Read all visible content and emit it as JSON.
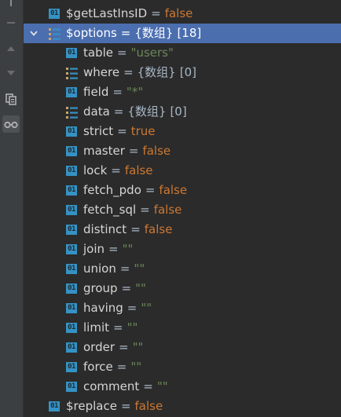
{
  "colors": {
    "selected_row": "#4b6eaf",
    "primitive_icon": "#3592c4",
    "false_value": "#cc7832",
    "string_value": "#6a8759",
    "background": "#2b2b2b"
  },
  "gutter": {
    "buttons": [
      {
        "name": "settings-icon"
      },
      {
        "name": "collapse-icon"
      },
      {
        "name": "up-arrow-icon"
      },
      {
        "name": "down-arrow-icon"
      },
      {
        "name": "copy-icon"
      },
      {
        "name": "glasses-icon",
        "active": true
      }
    ]
  },
  "rows": [
    {
      "level": 0,
      "icon": "primitive",
      "key": "$getLastInsID",
      "eq": "=",
      "value": "false",
      "kind": "false"
    },
    {
      "level": 0,
      "icon": "array",
      "key": "$options",
      "eq": "=",
      "value": "{数组}",
      "kind": "arr",
      "count": "[18]",
      "expanded": true,
      "selected": true
    },
    {
      "level": 1,
      "icon": "primitive",
      "key": "table",
      "eq": "=",
      "value": "\"users\"",
      "kind": "str"
    },
    {
      "level": 1,
      "icon": "array",
      "key": "where",
      "eq": "=",
      "value": "{数组}",
      "kind": "arr",
      "count": "[0]"
    },
    {
      "level": 1,
      "icon": "primitive",
      "key": "field",
      "eq": "=",
      "value": "\"*\"",
      "kind": "str"
    },
    {
      "level": 1,
      "icon": "array",
      "key": "data",
      "eq": "=",
      "value": "{数组}",
      "kind": "arr",
      "count": "[0]"
    },
    {
      "level": 1,
      "icon": "primitive",
      "key": "strict",
      "eq": "=",
      "value": "true",
      "kind": "true"
    },
    {
      "level": 1,
      "icon": "primitive",
      "key": "master",
      "eq": "=",
      "value": "false",
      "kind": "false"
    },
    {
      "level": 1,
      "icon": "primitive",
      "key": "lock",
      "eq": "=",
      "value": "false",
      "kind": "false"
    },
    {
      "level": 1,
      "icon": "primitive",
      "key": "fetch_pdo",
      "eq": "=",
      "value": "false",
      "kind": "false"
    },
    {
      "level": 1,
      "icon": "primitive",
      "key": "fetch_sql",
      "eq": "=",
      "value": "false",
      "kind": "false"
    },
    {
      "level": 1,
      "icon": "primitive",
      "key": "distinct",
      "eq": "=",
      "value": "false",
      "kind": "false"
    },
    {
      "level": 1,
      "icon": "primitive",
      "key": "join",
      "eq": "=",
      "value": "\"\"",
      "kind": "str"
    },
    {
      "level": 1,
      "icon": "primitive",
      "key": "union",
      "eq": "=",
      "value": "\"\"",
      "kind": "str"
    },
    {
      "level": 1,
      "icon": "primitive",
      "key": "group",
      "eq": "=",
      "value": "\"\"",
      "kind": "str"
    },
    {
      "level": 1,
      "icon": "primitive",
      "key": "having",
      "eq": "=",
      "value": "\"\"",
      "kind": "str"
    },
    {
      "level": 1,
      "icon": "primitive",
      "key": "limit",
      "eq": "=",
      "value": "\"\"",
      "kind": "str"
    },
    {
      "level": 1,
      "icon": "primitive",
      "key": "order",
      "eq": "=",
      "value": "\"\"",
      "kind": "str"
    },
    {
      "level": 1,
      "icon": "primitive",
      "key": "force",
      "eq": "=",
      "value": "\"\"",
      "kind": "str"
    },
    {
      "level": 1,
      "icon": "primitive",
      "key": "comment",
      "eq": "=",
      "value": "\"\"",
      "kind": "str"
    },
    {
      "level": 0,
      "icon": "primitive",
      "key": "$replace",
      "eq": "=",
      "value": "false",
      "kind": "false"
    }
  ],
  "icon_label": "01"
}
